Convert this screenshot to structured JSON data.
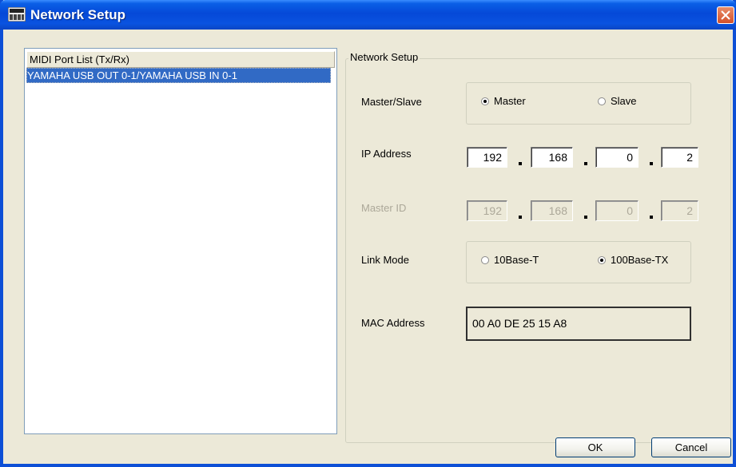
{
  "window": {
    "title": "Network Setup"
  },
  "midi_list": {
    "header": "MIDI Port List (Tx/Rx)",
    "items": [
      "YAMAHA USB OUT 0-1/YAMAHA USB IN 0-1"
    ]
  },
  "network": {
    "group_caption": "Network Setup",
    "master_slave": {
      "label": "Master/Slave",
      "options": [
        "Master",
        "Slave"
      ],
      "selected": "Master"
    },
    "ip_address": {
      "label": "IP Address",
      "octets": [
        "192",
        "168",
        "0",
        "2"
      ]
    },
    "master_id": {
      "label": "Master ID",
      "octets": [
        "192",
        "168",
        "0",
        "2"
      ],
      "disabled": true
    },
    "link_mode": {
      "label": "Link Mode",
      "options": [
        "10Base-T",
        "100Base-TX"
      ],
      "selected": "100Base-TX"
    },
    "mac_address": {
      "label": "MAC Address",
      "value": "00 A0 DE 25 15 A8"
    }
  },
  "buttons": {
    "ok_label": "OK",
    "cancel_label": "Cancel"
  },
  "colors": {
    "title_bar": "#0549d8",
    "selection": "#316ac5",
    "dialog_bg": "#ece9d8"
  }
}
